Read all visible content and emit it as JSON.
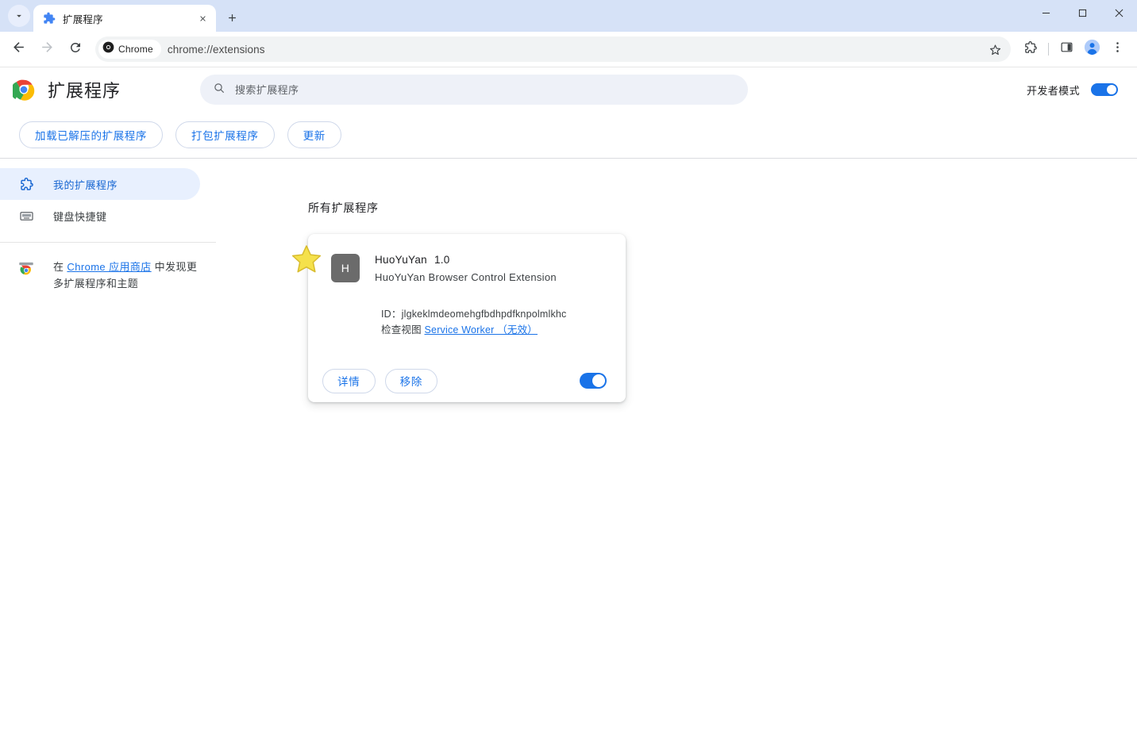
{
  "window": {
    "controls": {
      "minimize": "−",
      "maximize": "□",
      "close": "✕"
    }
  },
  "tabstrip": {
    "tab_search_icon": "chevron-down-icon",
    "tabs": [
      {
        "title": "扩展程序",
        "favicon": "puzzle-piece-icon",
        "close_icon": "close-icon",
        "active": true
      }
    ],
    "new_tab_label": "+"
  },
  "toolbar": {
    "back_icon": "arrow-back-icon",
    "forward_icon": "arrow-forward-icon",
    "reload_icon": "reload-icon",
    "chrome_chip_label": "Chrome",
    "url": "chrome://extensions",
    "bookmark_icon": "star-outline-icon",
    "extensions_icon": "puzzle-piece-icon",
    "side_panel_icon": "side-panel-icon",
    "profile_icon": "account-avatar-icon",
    "menu_icon": "three-dot-menu-icon"
  },
  "header": {
    "logo_icon": "chrome-logo-icon",
    "title": "扩展程序",
    "search": {
      "placeholder": "搜索扩展程序",
      "value": "",
      "icon": "search-icon"
    },
    "dev_mode": {
      "label": "开发者模式",
      "enabled": true
    },
    "actions": [
      {
        "label": "加载已解压的扩展程序",
        "name": "load-unpacked-button"
      },
      {
        "label": "打包扩展程序",
        "name": "pack-extension-button"
      },
      {
        "label": "更新",
        "name": "update-button"
      }
    ]
  },
  "sidebar": {
    "items": [
      {
        "label": "我的扩展程序",
        "icon": "puzzle-piece-icon",
        "active": true
      },
      {
        "label": "键盘快捷键",
        "icon": "keyboard-icon",
        "active": false
      }
    ],
    "store": {
      "icon": "chrome-web-store-icon",
      "prefix": "在 ",
      "link": "Chrome 应用商店",
      "suffix": " 中发现更多扩展程序和主题"
    }
  },
  "main": {
    "heading": "所有扩展程序",
    "extensions": [
      {
        "icon_letter": "H",
        "icon_bg": "#6b6b6b",
        "name": "HuoYuYan",
        "version": "1.0",
        "description": "HuoYuYan Browser Control Extension",
        "id_label": "ID：",
        "id_value": "jlgkeklmdeomehgfbdhpdfknpolmlkhc",
        "inspect_label": "检查视图",
        "inspect_link": "Service Worker （无效）",
        "details_button": "详情",
        "remove_button": "移除",
        "enabled": true,
        "annotation": "star-marker"
      }
    ]
  },
  "colors": {
    "accent_blue": "#1a73e8",
    "tab_strip_bg": "#d6e2f7",
    "active_sidebar_bg": "#e8f0fe",
    "search_bg": "#eef1f8",
    "star_fill": "#f5e14b"
  }
}
